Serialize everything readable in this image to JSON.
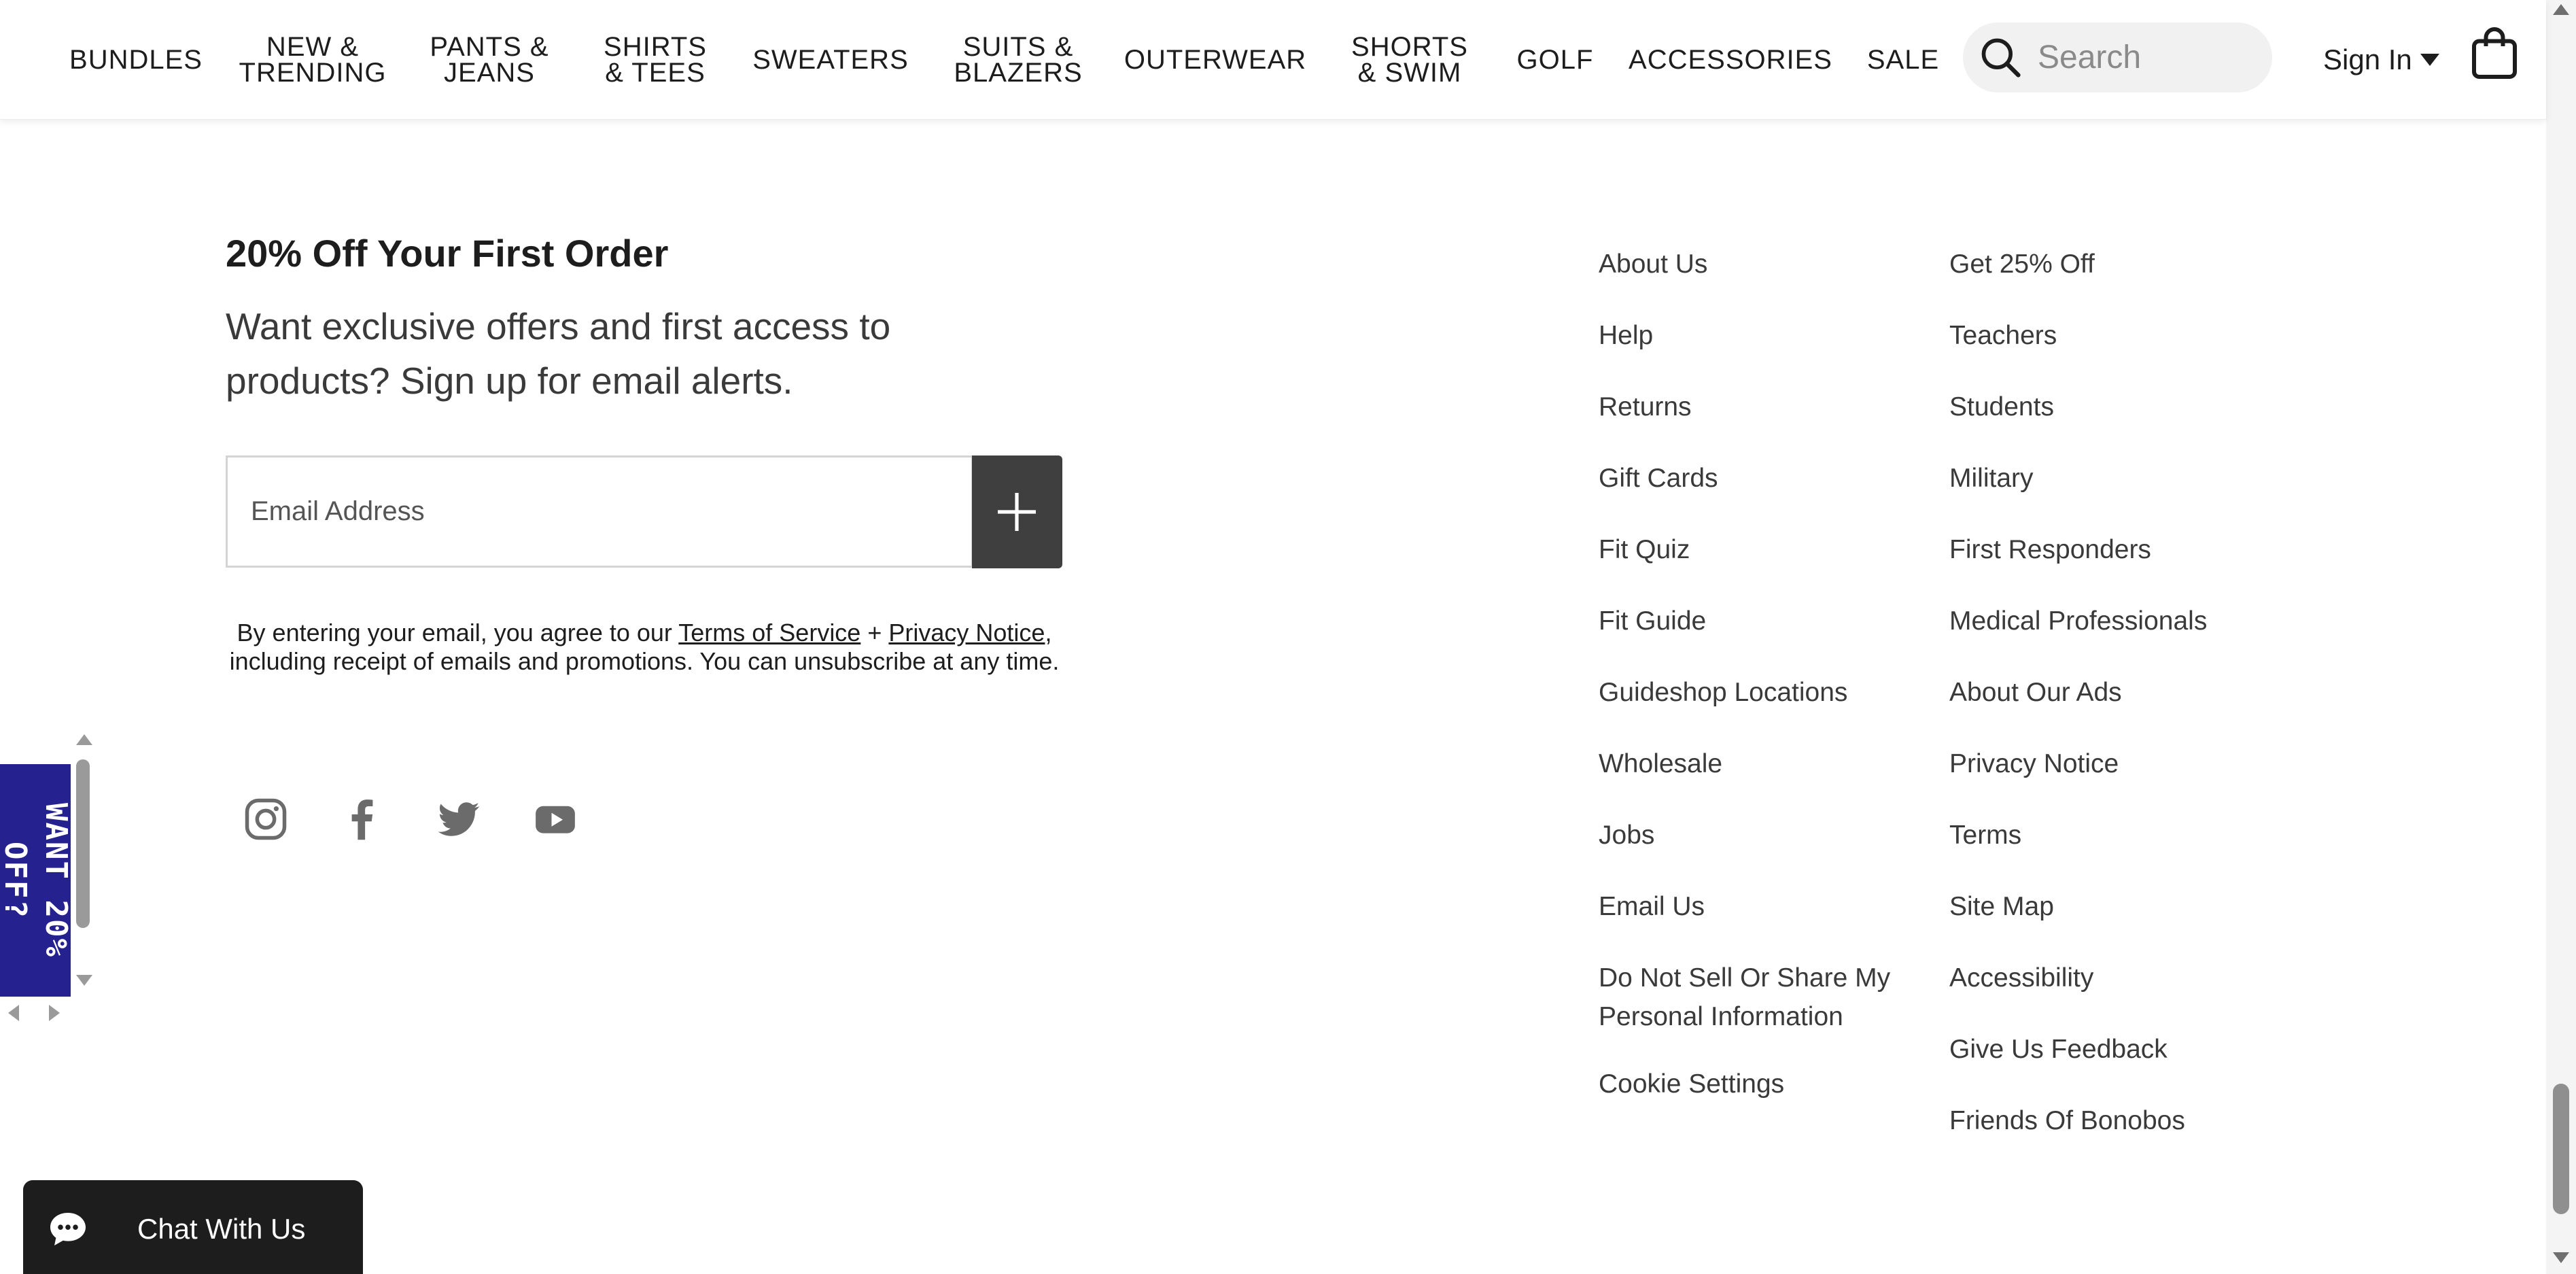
{
  "header": {
    "nav": [
      {
        "id": "bundles",
        "label": "BUNDLES"
      },
      {
        "id": "new-trending",
        "label": "NEW &\nTRENDING"
      },
      {
        "id": "pants-jeans",
        "label": "PANTS &\nJEANS"
      },
      {
        "id": "shirts-tees",
        "label": "SHIRTS\n& TEES"
      },
      {
        "id": "sweaters",
        "label": "SWEATERS"
      },
      {
        "id": "suits-blazers",
        "label": "SUITS &\nBLAZERS"
      },
      {
        "id": "outerwear",
        "label": "OUTERWEAR"
      },
      {
        "id": "shorts-swim",
        "label": "SHORTS\n& SWIM"
      },
      {
        "id": "golf",
        "label": "GOLF"
      },
      {
        "id": "accessories",
        "label": "ACCESSORIES"
      },
      {
        "id": "sale",
        "label": "SALE"
      }
    ],
    "search": {
      "placeholder": "Search",
      "value": "",
      "icon": "search-icon"
    },
    "sign_in": {
      "label": "Sign In",
      "icon": "caret-down-icon"
    },
    "cart": {
      "icon": "shopping-bag-icon"
    }
  },
  "newsletter": {
    "title": "20% Off Your First Order",
    "text": "Want exclusive offers and first access to products? Sign up for email alerts.",
    "email": {
      "placeholder": "Email Address",
      "value": ""
    },
    "submit": {
      "icon": "plus-icon"
    },
    "legal": {
      "before": "By entering your email, you agree to our ",
      "terms_link": "Terms of Service",
      "middle": " + ",
      "privacy_link": "Privacy Notice",
      "after": ", including receipt of emails and promotions. You can unsubscribe at any time."
    },
    "socials": [
      {
        "id": "instagram",
        "icon": "instagram-icon"
      },
      {
        "id": "facebook",
        "icon": "facebook-icon"
      },
      {
        "id": "twitter",
        "icon": "twitter-icon"
      },
      {
        "id": "youtube",
        "icon": "youtube-icon"
      }
    ]
  },
  "footer": {
    "column_1": [
      "About Us",
      "Help",
      "Returns",
      "Gift Cards",
      "Fit Quiz",
      "Fit Guide",
      "Guideshop Locations",
      "Wholesale",
      "Jobs",
      "Email Us",
      "Do Not Sell Or Share My\nPersonal Information",
      "Cookie Settings"
    ],
    "column_2": [
      "Get 25% Off",
      "Teachers",
      "Students",
      "Military",
      "First Responders",
      "Medical Professionals",
      "About Our Ads",
      "Privacy Notice",
      "Terms",
      "Site Map",
      "Accessibility",
      "Give Us Feedback",
      "Friends Of Bonobos"
    ]
  },
  "promo_tab": {
    "label": "WANT 20%\nOFF?",
    "color": "#25218f"
  },
  "chat": {
    "label": "Chat With Us",
    "icon": "chat-bubble-icon",
    "color": "#1d1d1d"
  },
  "colors": {
    "text": "#1d1d1d",
    "muted_text": "#3a3a3a",
    "search_bg": "#f1f1f1",
    "submit_bg": "#3f3f3f",
    "promo": "#25218f"
  }
}
